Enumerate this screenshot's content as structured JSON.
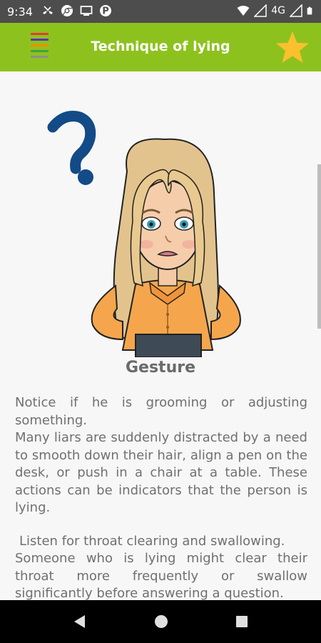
{
  "status_bar": {
    "time": "9:34",
    "network": "4G",
    "left_icons": [
      "missed-call-icon",
      "chrome-icon",
      "cast-icon",
      "parking-icon"
    ],
    "right_icons": [
      "wifi-icon",
      "signal-icon",
      "battery-icon"
    ]
  },
  "app_bar": {
    "title": "Technique of lying",
    "background": "#8dc21e",
    "menu_icon": "hamburger-icon",
    "menu_stripe_colors": [
      "#e53935",
      "#5e35b1",
      "#fb8c00",
      "#43a047",
      "#8e8e8e"
    ],
    "favorite_icon": "star-icon",
    "star_color": "#fbc02d"
  },
  "content": {
    "illustration": "confused-woman-avatar",
    "section_title": "Gesture",
    "paragraphs": [
      "Notice if he is grooming or adjusting something.",
      "Many liars are suddenly distracted by a need to smooth down their hair, align a pen on the desk, or push in a chair at a table. These actions can be indicators that the person is lying.",
      "Listen for throat clearing and swallowing.",
      "Someone who is lying might clear their throat more frequently or swallow significantly before answering a question."
    ]
  },
  "nav_bar": {
    "icons": [
      "back-icon",
      "home-icon",
      "recents-icon"
    ]
  }
}
